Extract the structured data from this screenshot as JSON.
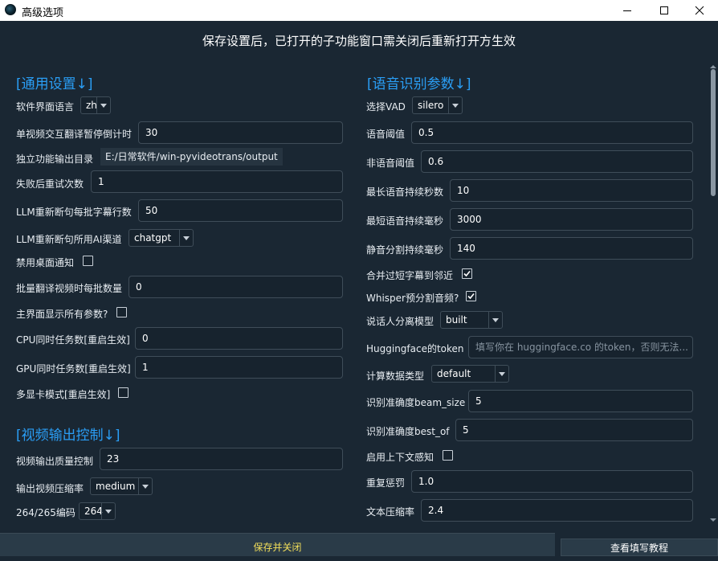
{
  "window": {
    "title": "高级选项"
  },
  "header_note": "保存设置后，已打开的子功能窗口需关闭后重新打开方生效",
  "sections": {
    "general": "[通用设置↓]",
    "speech": "[语音识别参数↓]",
    "video": "[视频输出控制↓]"
  },
  "general": {
    "ui_language": {
      "label": "软件界面语言",
      "value": "zh"
    },
    "countdown": {
      "label": "单视频交互翻译暂停倒计时",
      "value": "30"
    },
    "output_dir": {
      "label": "独立功能输出目录",
      "value": "E:/日常软件/win-pyvideotrans/output"
    },
    "retry": {
      "label": "失败后重试次数",
      "value": "1"
    },
    "llm_batch": {
      "label": "LLM重新断句每批字幕行数",
      "value": "50"
    },
    "llm_channel": {
      "label": "LLM重新断句所用AI渠道",
      "value": "chatgpt"
    },
    "disable_notify": {
      "label": "禁用桌面通知"
    },
    "batch_count": {
      "label": "批量翻译视频时每批数量",
      "value": "0"
    },
    "show_all": {
      "label": "主界面显示所有参数?"
    },
    "cpu_tasks": {
      "label": "CPU同时任务数[重启生效]",
      "value": "0"
    },
    "gpu_tasks": {
      "label": "GPU同时任务数[重启生效]",
      "value": "1"
    },
    "multi_gpu": {
      "label": "多显卡模式[重启生效]"
    }
  },
  "video": {
    "quality": {
      "label": "视频输出质量控制",
      "value": "23"
    },
    "preset": {
      "label": "输出视频压缩率",
      "value": "medium"
    },
    "codec": {
      "label": "264/265编码",
      "value": "264"
    }
  },
  "speech": {
    "vad": {
      "label": "选择VAD",
      "value": "silero"
    },
    "threshold": {
      "label": "语音阈值",
      "value": "0.5"
    },
    "neg_threshold": {
      "label": "非语音阈值",
      "value": "0.6"
    },
    "max_speech": {
      "label": "最长语音持续秒数",
      "value": "10"
    },
    "min_speech": {
      "label": "最短语音持续毫秒",
      "value": "3000"
    },
    "min_silence": {
      "label": "静音分割持续毫秒",
      "value": "140"
    },
    "merge_short": {
      "label": "合并过短字幕到邻近",
      "checked": true
    },
    "whisper_presplit": {
      "label": "Whisper预分割音频?",
      "checked": true
    },
    "diarization": {
      "label": "说话人分离模型",
      "value": "built"
    },
    "hf_token": {
      "label": "Huggingface的token",
      "placeholder": "填写你在 huggingface.co 的token，否则无法..."
    },
    "compute_type": {
      "label": "计算数据类型",
      "value": "default"
    },
    "beam_size": {
      "label": "识别准确度beam_size",
      "value": "5"
    },
    "best_of": {
      "label": "识别准确度best_of",
      "value": "5"
    },
    "context_aware": {
      "label": "启用上下文感知"
    },
    "repeat_penalty": {
      "label": "重复惩罚",
      "value": "1.0"
    },
    "compression_ratio": {
      "label": "文本压缩率",
      "value": "2.4"
    }
  },
  "buttons": {
    "save_close": "保存并关闭",
    "tutorial": "查看填写教程"
  }
}
